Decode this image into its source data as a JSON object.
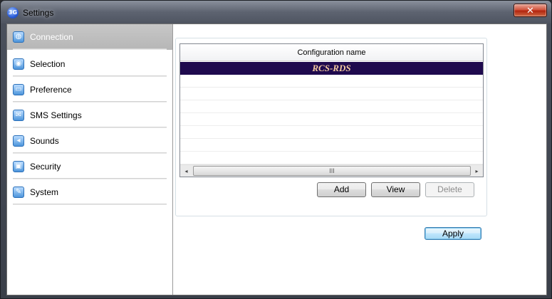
{
  "window": {
    "title": "Settings",
    "app_icon_text": "3G",
    "close_glyph": "✕"
  },
  "sidebar": {
    "items": [
      {
        "label": "Connection",
        "icon": "globe-icon",
        "glyph": "◍",
        "active": true
      },
      {
        "label": "Selection",
        "icon": "selection-icon",
        "glyph": "◉",
        "active": false
      },
      {
        "label": "Preference",
        "icon": "monitor-icon",
        "glyph": "▭",
        "active": false
      },
      {
        "label": "SMS Settings",
        "icon": "envelope-icon",
        "glyph": "✉",
        "active": false
      },
      {
        "label": "Sounds",
        "icon": "speaker-icon",
        "glyph": "◂",
        "active": false
      },
      {
        "label": "Security",
        "icon": "lock-icon",
        "glyph": "▣",
        "active": false
      },
      {
        "label": "System",
        "icon": "wrench-icon",
        "glyph": "✎",
        "active": false
      }
    ]
  },
  "configurations": {
    "column_header": "Configuration name",
    "rows": [
      "RCS-RDS"
    ],
    "selected_index": 0,
    "scrollbar": {
      "left_arrow": "◂",
      "right_arrow": "▸",
      "thumb_grip": "III"
    }
  },
  "buttons": {
    "add": "Add",
    "view": "View",
    "delete": "Delete",
    "apply": "Apply"
  },
  "colors": {
    "selected_row_bg": "#1f0a4e",
    "selected_row_text": "#f3c9a0",
    "active_sidebar_bg": "#bcbcbc",
    "close_button": "#c0391f"
  }
}
